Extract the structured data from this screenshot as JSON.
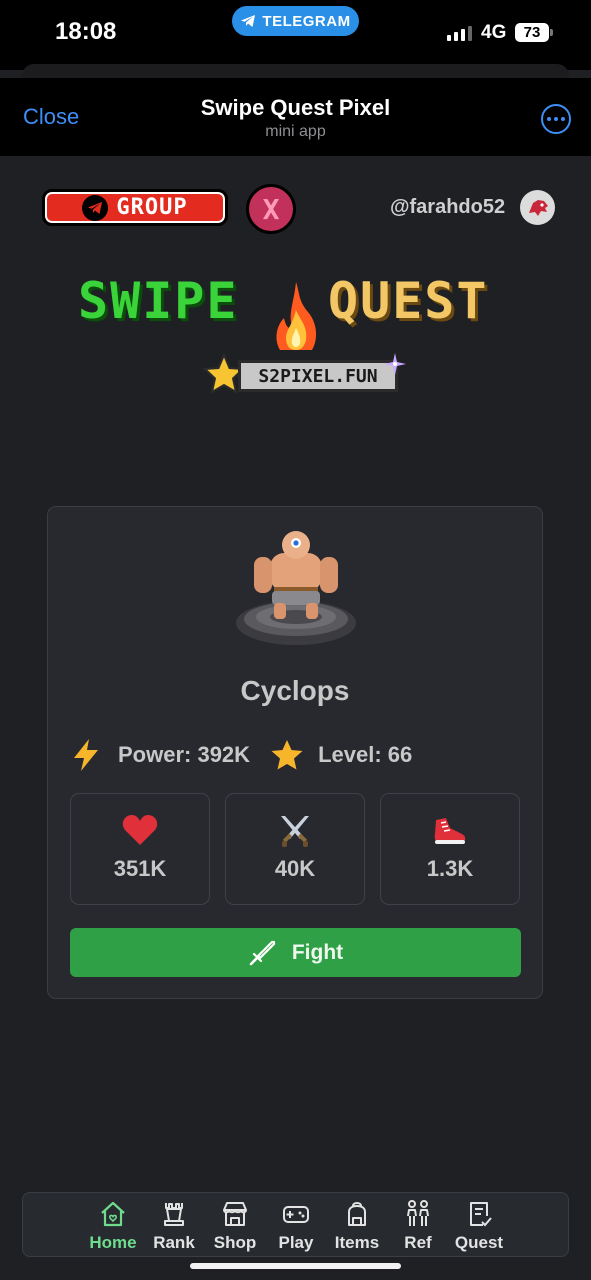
{
  "status_bar": {
    "time": "18:08",
    "app_pill": "TELEGRAM",
    "network": "4G",
    "battery": "73"
  },
  "header": {
    "close_label": "Close",
    "title": "Swipe Quest Pixel",
    "subtitle": "mini app"
  },
  "top_row": {
    "group_label": "GROUP",
    "x_label": "X",
    "username": "@farahdo52"
  },
  "logo": {
    "word1": "SWIPE",
    "word2": "QUEST",
    "site": "S2PIXEL.FUN"
  },
  "monster": {
    "name": "Cyclops",
    "power_label": "Power: 392K",
    "level_label": "Level: 66",
    "health": "351K",
    "attack": "40K",
    "speed": "1.3K",
    "fight_label": "Fight"
  },
  "nav": {
    "items": [
      {
        "label": "Home",
        "icon": "home-icon",
        "active": true
      },
      {
        "label": "Rank",
        "icon": "chess-rook-icon"
      },
      {
        "label": "Shop",
        "icon": "store-icon"
      },
      {
        "label": "Play",
        "icon": "gamepad-icon"
      },
      {
        "label": "Items",
        "icon": "backpack-icon"
      },
      {
        "label": "Ref",
        "icon": "people-icon"
      },
      {
        "label": "Quest",
        "icon": "checklist-icon"
      }
    ]
  },
  "colors": {
    "accent_blue": "#3e8ef7",
    "fight_green": "#2fa045",
    "nav_active": "#6fdc8c",
    "group_red": "#e32b1f"
  }
}
